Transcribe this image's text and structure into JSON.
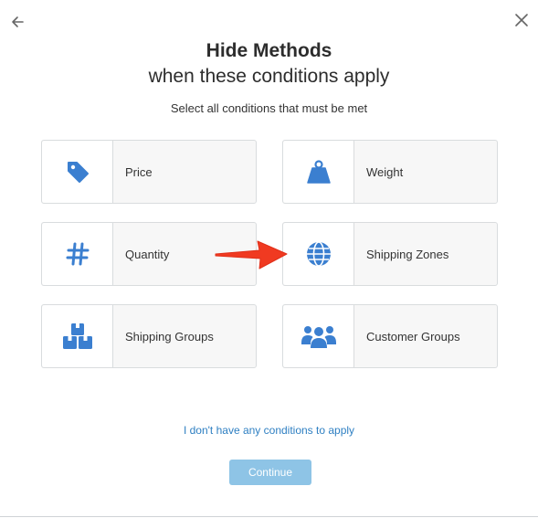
{
  "header": {
    "title": "Hide Methods",
    "subtitle": "when these conditions apply",
    "instruction": "Select all conditions that must be met",
    "back_icon": "back-arrow-icon",
    "close_icon": "close-icon"
  },
  "conditions": [
    {
      "label": "Price",
      "icon": "price-tag-icon"
    },
    {
      "label": "Weight",
      "icon": "weight-icon"
    },
    {
      "label": "Quantity",
      "icon": "hash-icon"
    },
    {
      "label": "Shipping Zones",
      "icon": "globe-icon"
    },
    {
      "label": "Shipping Groups",
      "icon": "boxes-icon"
    },
    {
      "label": "Customer Groups",
      "icon": "users-icon"
    }
  ],
  "footer": {
    "no_conditions_link": "I don't have any conditions to apply",
    "continue_label": "Continue"
  },
  "colors": {
    "icon_blue": "#3b7fd0",
    "link_blue": "#2e7fc2",
    "button_disabled": "#8ec4e6",
    "annotation_arrow": "#f03a21"
  }
}
